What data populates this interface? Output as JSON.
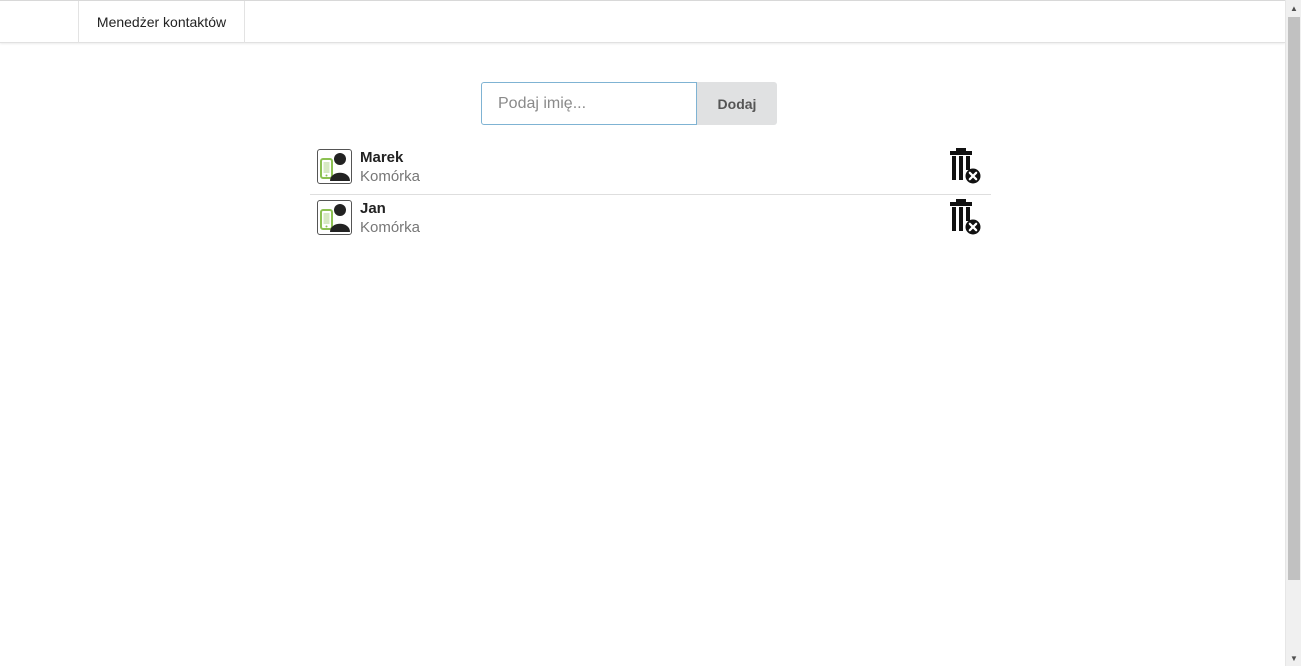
{
  "navbar": {
    "title": "Menedżer kontaktów"
  },
  "add_form": {
    "input_value": "",
    "input_placeholder": "Podaj imię...",
    "button_label": "Dodaj"
  },
  "contacts": [
    {
      "name": "Marek",
      "type": "Komórka",
      "avatar_icon": "mobile-contact-icon",
      "delete_icon": "trash-remove-icon"
    },
    {
      "name": "Jan",
      "type": "Komórka",
      "avatar_icon": "mobile-contact-icon",
      "delete_icon": "trash-remove-icon"
    }
  ],
  "colors": {
    "input_border": "#7fb3d3",
    "button_bg": "#e0e1e2",
    "phone_green": "#8cc152",
    "row_divider": "#dedede"
  }
}
